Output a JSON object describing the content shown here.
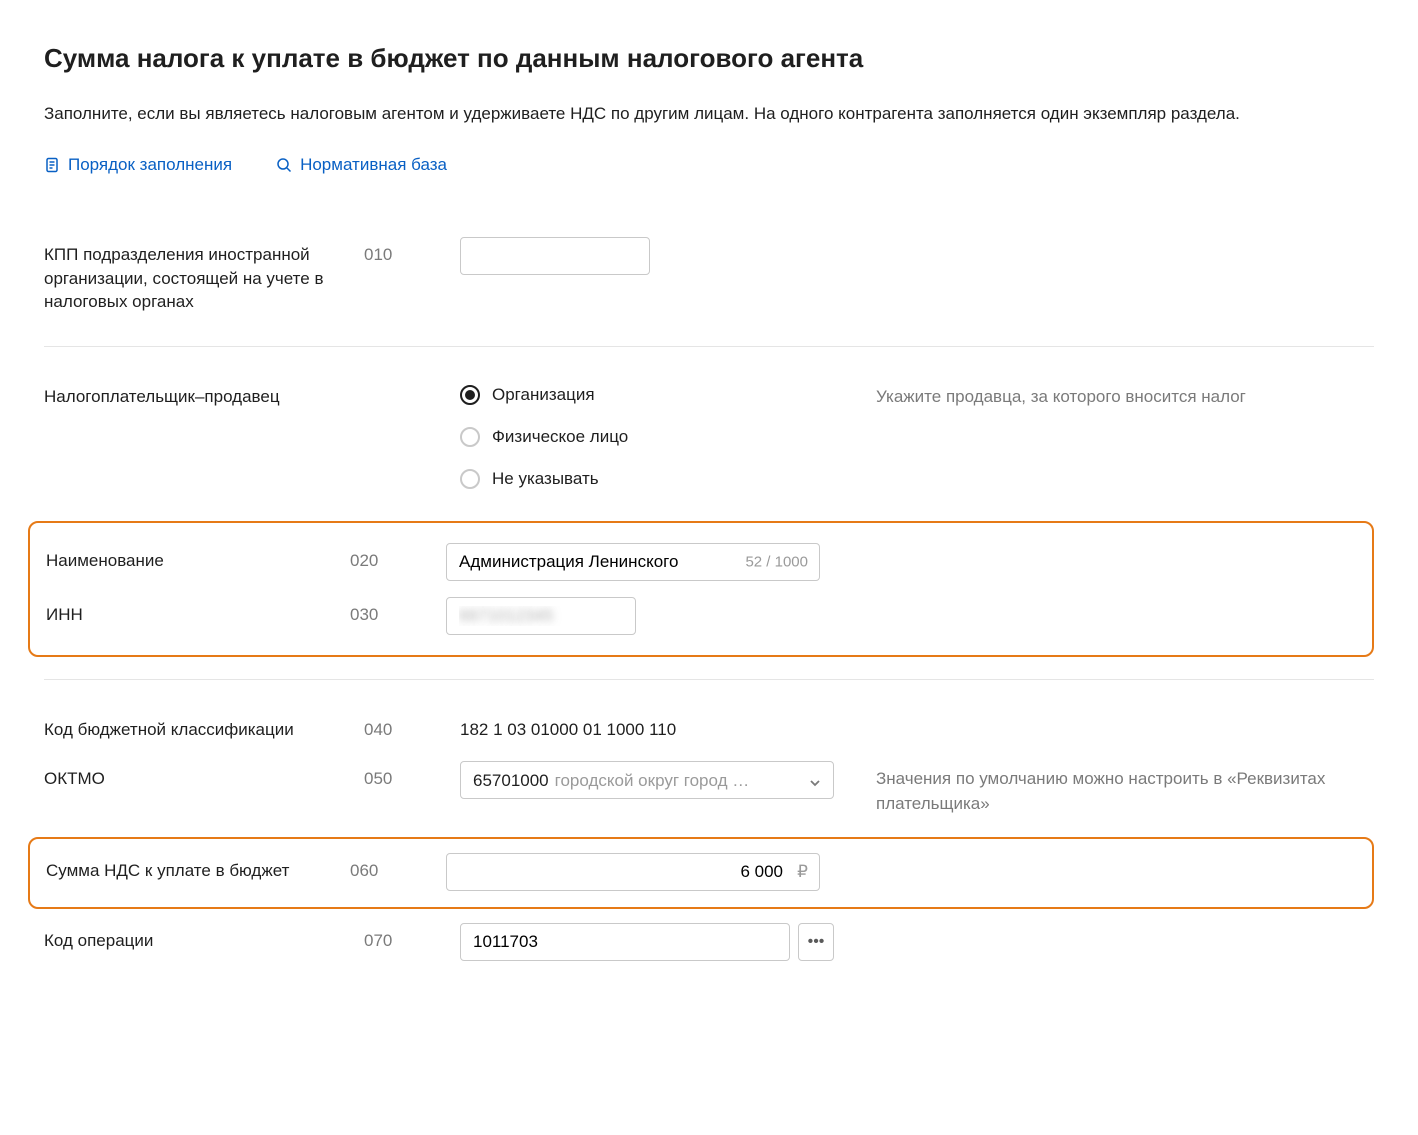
{
  "heading": "Сумма налога к уплате в бюджет по данным налогового агента",
  "description": "Заполните, если вы являетесь налоговым агентом и удерживаете НДС по другим лицам. На одного контрагента заполняется один экземпляр раздела.",
  "links": {
    "fill_order": "Порядок заполнения",
    "legal_base": "Нормативная база"
  },
  "fields": {
    "kpp": {
      "label": "КПП подразделения иностранной организации, состоящей на учете в налоговых органах",
      "code": "010",
      "value": ""
    },
    "seller_type": {
      "label": "Налогоплательщик–продавец",
      "hint": "Укажите продавца, за которого вносится налог",
      "options": {
        "org": "Организация",
        "person": "Физическое лицо",
        "none": "Не указывать"
      },
      "selected": "org"
    },
    "name": {
      "label": "Наименование",
      "code": "020",
      "value": "Администрация Ленинского",
      "counter": "52 / 1000"
    },
    "inn": {
      "label": "ИНН",
      "code": "030",
      "value": "6671012345"
    },
    "kbk": {
      "label": "Код бюджетной классификации",
      "code": "040",
      "value": "182 1 03 01000 01 1000 110"
    },
    "oktmo": {
      "label": "ОКТМО",
      "code": "050",
      "selected_code": "65701000",
      "selected_name": "городской округ город …",
      "hint": "Значения по умолчанию можно настроить в «Реквизитах плательщика»"
    },
    "nds_sum": {
      "label": "Сумма НДС к уплате в бюджет",
      "code": "060",
      "value": "6 000"
    },
    "op_code": {
      "label": "Код операции",
      "code": "070",
      "value": "1011703"
    }
  }
}
